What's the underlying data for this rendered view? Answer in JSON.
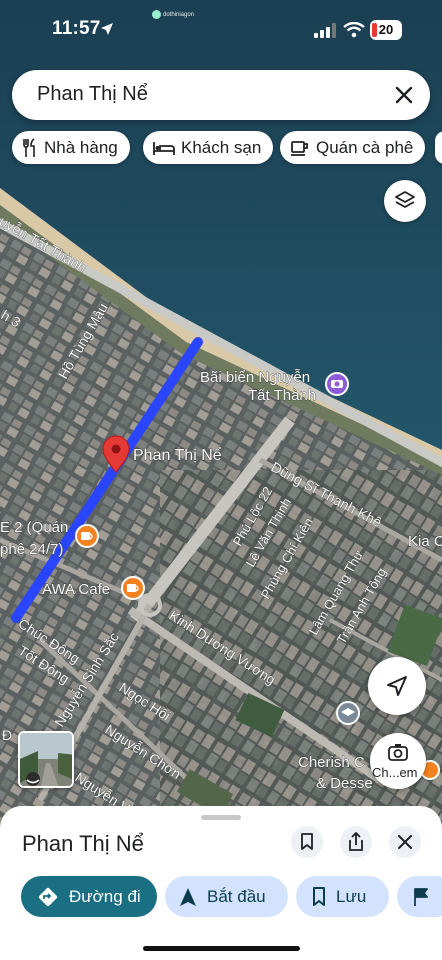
{
  "status_bar": {
    "time": "11:57",
    "watermark": "dothiniagon",
    "battery": "20"
  },
  "search": {
    "query": "Phan Thị Nể"
  },
  "categories": [
    {
      "label": "Nhà hàng",
      "icon": "restaurant-icon"
    },
    {
      "label": "Khách sạn",
      "icon": "hotel-icon"
    },
    {
      "label": "Quán cà phê",
      "icon": "coffee-icon"
    }
  ],
  "map": {
    "selected_place": "Phan Thị Nể",
    "colors": {
      "route": "#2a45ff",
      "pin": "#e53935",
      "poi_orange": "#f58220",
      "poi_purple": "#8e5cd6"
    },
    "pois": {
      "beach_line1": "Bãi biển Nguyễn",
      "beach_line2": "Tất Thành",
      "awa": "AWA Cafe",
      "cafe2_line1": "E 2 (Quán",
      "cafe2_line2": "phê 24/7)",
      "cherish_line1": "Cherish C",
      "cherish_line2": "& Desse",
      "kia": "Kia C"
    },
    "streets": {
      "nguyen_tat_thanh": "uyễn Tất Thành",
      "ho_tung_mau": "Hồ Tùng Mậu",
      "street3": "h 3",
      "dung_si": "Dũng Sĩ Thanh Khê",
      "phu_loc_22": "Phú Lộc 22",
      "le_van_thinh": "Lê Văn Thịnh",
      "phung_chi_kien": "Phùng Chí Kiên",
      "lam_quang_thu": "Lâm Quang Thự",
      "tran_anh_tong": "Trần Anh Tông",
      "kinh_duong_vuong": "Kinh Dương Vương",
      "chuc_dong": "Chúc Động",
      "tot_dong": "Tốt Động",
      "nguyen_sinh_sac": "Nguyễn Sinh Sắc",
      "ngoc_hoi": "Ngọc Hồi",
      "nguyen_chon": "Nguyễn Chơn",
      "nguyen_v": "Nguyễn V",
      "dx": "Đ"
    }
  },
  "lens_label": "Ch...em",
  "sheet": {
    "title": "Phan Thị Nể",
    "actions": {
      "directions": "Đường đi",
      "start": "Bắt đầu",
      "save": "Lưu"
    }
  }
}
